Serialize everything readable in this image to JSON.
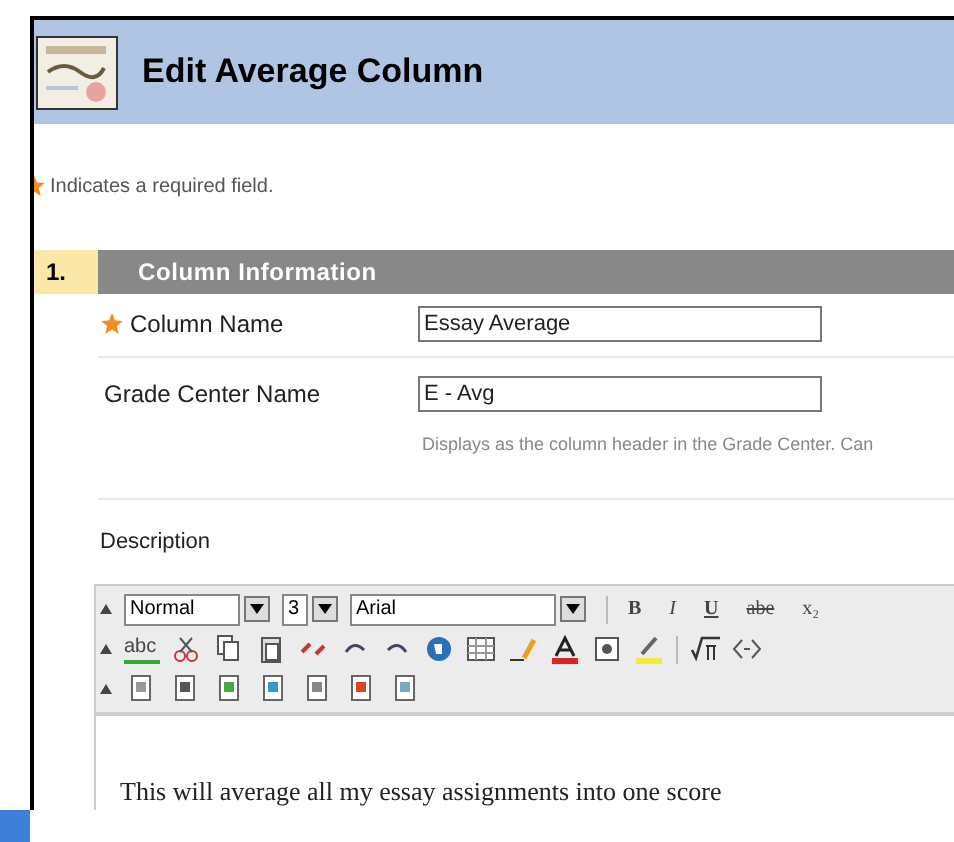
{
  "header": {
    "title": "Edit Average Column"
  },
  "required_note": "Indicates a required field.",
  "section": {
    "number": "1.",
    "title": "Column Information"
  },
  "fields": [
    {
      "label": "Column Name",
      "required": true,
      "value": "Essay Average"
    },
    {
      "label": "Grade Center Name",
      "required": false,
      "value": "E - Avg",
      "hint": "Displays as the column header in the Grade Center. Can"
    }
  ],
  "description": {
    "label": "Description",
    "toolbar": {
      "format": "Normal",
      "size": "3",
      "font": "Arial",
      "buttons": [
        "B",
        "I",
        "U",
        "abe",
        "x₂"
      ],
      "spell": "abc"
    },
    "text": "This will average all my essay assignments into one score"
  }
}
